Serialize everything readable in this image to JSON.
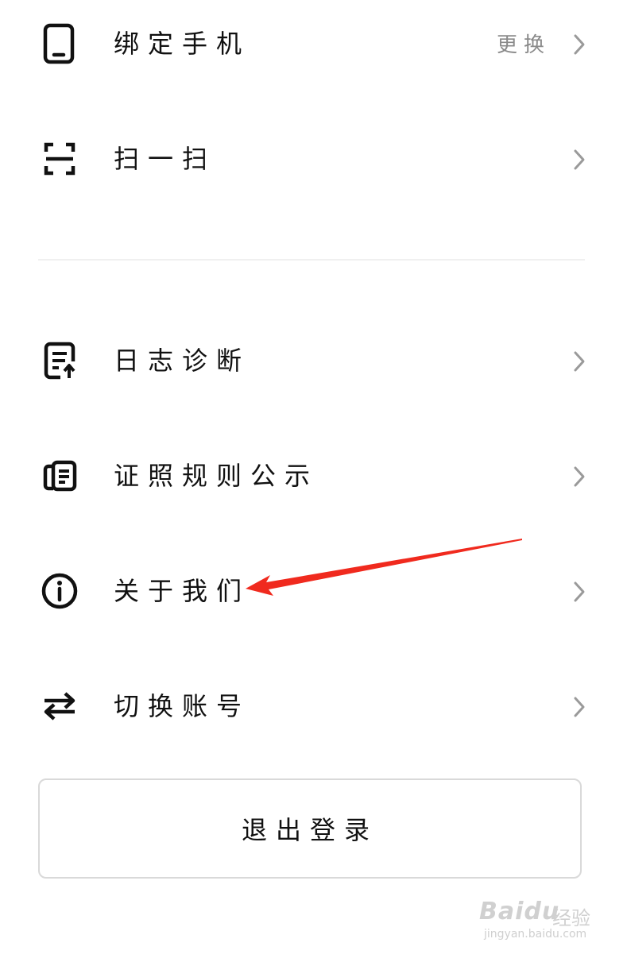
{
  "menu": {
    "bind_phone": {
      "label": "绑定手机",
      "right_text": "更换",
      "icon": "phone-icon"
    },
    "scan": {
      "label": "扫一扫",
      "icon": "scan-icon"
    },
    "log_diagnosis": {
      "label": "日志诊断",
      "icon": "log-upload-icon"
    },
    "license_rules": {
      "label": "证照规则公示",
      "icon": "license-icon"
    },
    "about_us": {
      "label": "关于我们",
      "icon": "info-icon"
    },
    "switch_account": {
      "label": "切换账号",
      "icon": "swap-icon"
    }
  },
  "logout": {
    "label": "退出登录"
  },
  "annotation": {
    "color": "#f02a1e"
  },
  "watermark": {
    "brand": "Baidu",
    "brand_cn": "经验",
    "url": "jingyan.baidu.com"
  }
}
